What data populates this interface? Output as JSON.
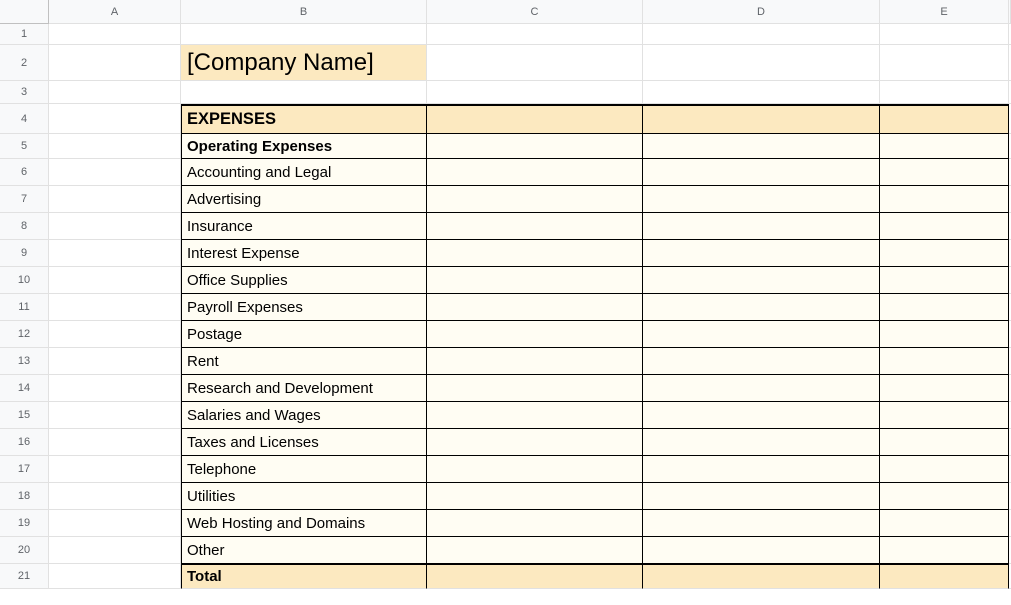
{
  "columns": [
    "A",
    "B",
    "C",
    "D",
    "E"
  ],
  "rows": [
    "1",
    "2",
    "3",
    "4",
    "5",
    "6",
    "7",
    "8",
    "9",
    "10",
    "11",
    "12",
    "13",
    "14",
    "15",
    "16",
    "17",
    "18",
    "19",
    "20",
    "21"
  ],
  "title": "[Company Name]",
  "section_header": "EXPENSES",
  "sub_header": "Operating Expenses",
  "items": [
    "Accounting and Legal",
    "Advertising",
    "Insurance",
    "Interest Expense",
    "Office Supplies",
    "Payroll Expenses",
    "Postage",
    "Rent",
    "Research and Development",
    "Salaries and Wages",
    "Taxes and Licenses",
    "Telephone",
    "Utilities",
    "Web Hosting and Domains",
    "Other"
  ],
  "total_label": "Total"
}
